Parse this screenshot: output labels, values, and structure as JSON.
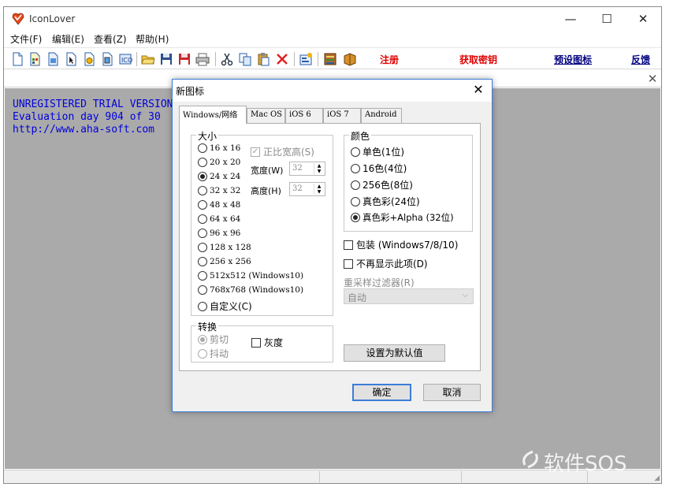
{
  "app": {
    "title": "IconLover"
  },
  "window_controls": {
    "minimize": "—",
    "maximize": "☐",
    "close": "✕"
  },
  "menu": [
    "文件(F)",
    "编辑(E)",
    "查看(Z)",
    "帮助(H)"
  ],
  "toolbar": {
    "icons": [
      "new-icon",
      "new-library-icon",
      "new-image-list-icon",
      "new-cursor-icon",
      "new-animated-cursor-icon",
      "new-icon-library-icon",
      "create-windows-icon",
      "open-folder-icon",
      "save-icon",
      "save-all-icon",
      "print-icon",
      "cut-icon",
      "copy-icon",
      "paste-icon",
      "delete-icon",
      "properties-icon",
      "resources-icon",
      "library-book-icon"
    ],
    "register": "注册",
    "get_key": "获取密钥",
    "preset_icons": "预设图标",
    "feedback": "反馈",
    "colors": {
      "red": "#e00000",
      "navy": "#000080"
    }
  },
  "doc_close": "✕",
  "workspace": {
    "lines": [
      "UNREGISTERED TRIAL VERSION",
      "Evaluation day 904 of 30",
      "http://www.aha-soft.com"
    ],
    "text_color": "#0000dd",
    "background": "#aaaaaa"
  },
  "watermark": "软件SOS",
  "dialog": {
    "title": "新图标",
    "close": "✕",
    "tabs": [
      "Windows/网络",
      "Mac OS",
      "iOS 6",
      "iOS 7",
      "Android"
    ],
    "size_group": {
      "label": "大小",
      "options": [
        "16 x 16",
        "20 x 20",
        "24 x 24",
        "32 x 32",
        "48 x 48",
        "64 x 64",
        "96 x 96",
        "128 x 128",
        "256 x 256",
        "512x512 (Windows10)",
        "768x768 (Windows10)",
        "自定义(C)"
      ],
      "selected": "24 x 24",
      "proportional": "正比宽高(S)",
      "width_label": "宽度(W)",
      "width_value": "32",
      "height_label": "高度(H)",
      "height_value": "32"
    },
    "convert_group": {
      "label": "转换",
      "options": [
        "剪切",
        "抖动"
      ],
      "grayscale": "灰度"
    },
    "color_group": {
      "label": "颜色",
      "options": [
        "单色(1位)",
        "16色(4位)",
        "256色(8位)",
        "真色彩(24位)",
        "真色彩+Alpha (32位)"
      ],
      "selected": "真色彩+Alpha (32位)"
    },
    "pack": "包装 (Windows7/8/10)",
    "dont_show": "不再显示此项(D)",
    "resample_label": "重采样过滤器(R)",
    "resample_value": "自动",
    "set_default": "设置为默认值",
    "ok": "确定",
    "cancel": "取消",
    "accent": "#3b7dd8"
  }
}
